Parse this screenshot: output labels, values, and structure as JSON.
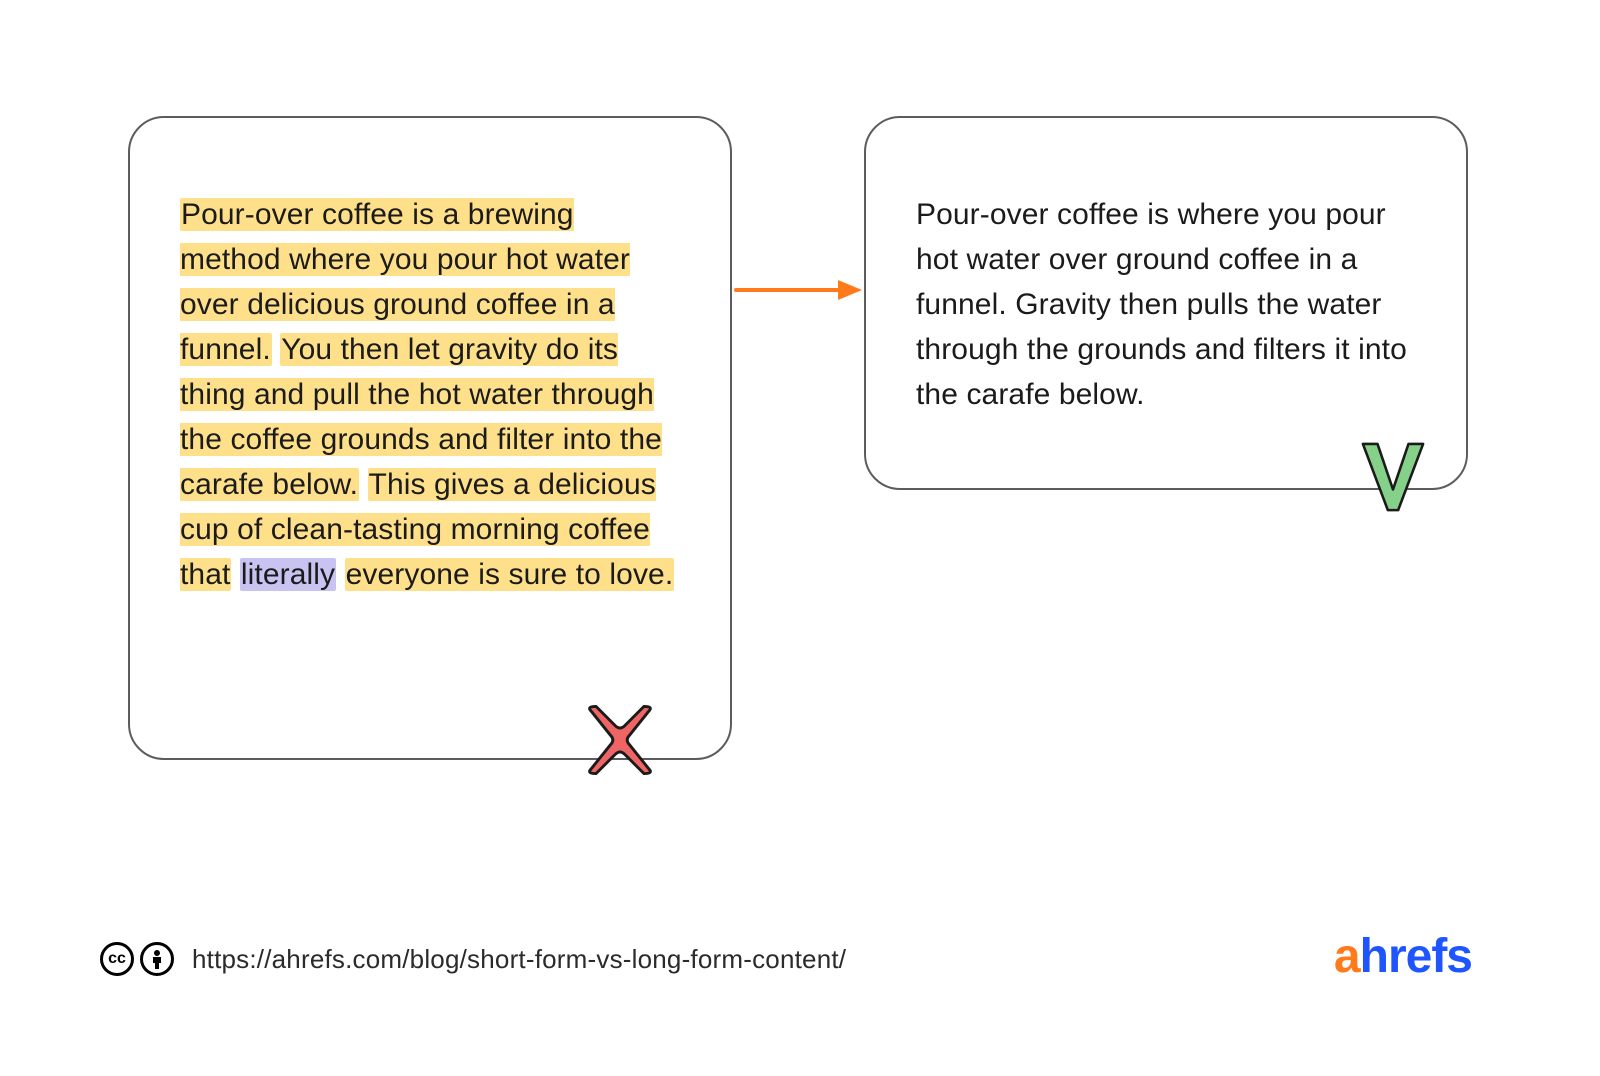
{
  "left_card": {
    "seg1": "Pour-over coffee is a brewing method where you pour hot water over delicious ground coffee in a funnel.",
    "seg2": "You then let gravity do its thing and pull the hot water through the coffee grounds and filter into the carafe below.",
    "seg3": "This gives a delicious cup of clean-tasting morning coffee that",
    "seg4_purple": "literally",
    "seg5": "everyone is sure to love."
  },
  "right_card": {
    "text": "Pour-over coffee is where you pour hot water over ground coffee in a funnel. Gravity then pulls the water through the grounds and filters it into the carafe below."
  },
  "footer": {
    "cc_label": "cc",
    "url": "https://ahrefs.com/blog/short-form-vs-long-form-content/"
  },
  "brand": {
    "part1": "a",
    "part2": "hrefs"
  },
  "colors": {
    "highlight_yellow": "#ffe08a",
    "highlight_purple": "#c7c4f2",
    "arrow": "#ff7a1a",
    "x_badge": "#ef6565",
    "check_badge": "#85d18a",
    "brand_orange": "#ff7a1a",
    "brand_blue": "#1e55ff"
  },
  "icons": {
    "x": "cross-icon",
    "check": "check-icon",
    "arrow": "arrow-right-icon",
    "cc": "creative-commons-icon",
    "attribution": "attribution-icon"
  }
}
